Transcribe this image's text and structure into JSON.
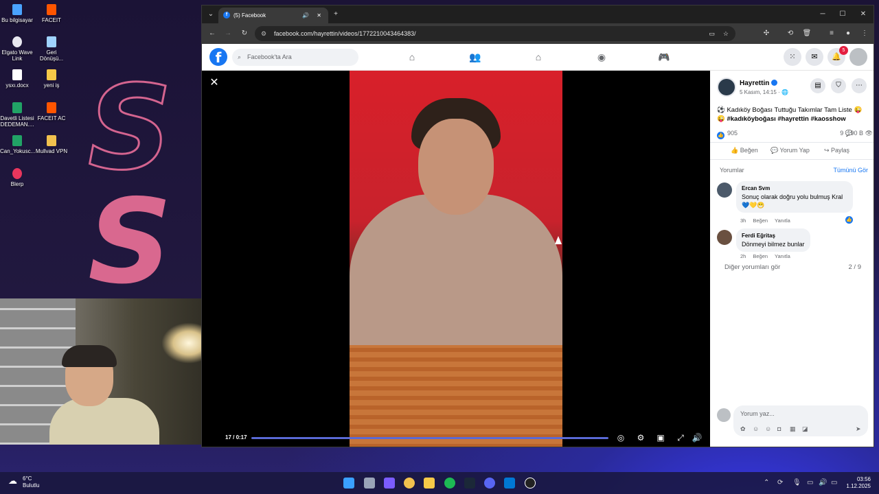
{
  "desktop": {
    "icons": [
      {
        "label": "Bu bilgisayar",
        "icon": "computer-icon",
        "color": "#4aa3ff"
      },
      {
        "label": "FACEIT",
        "icon": "faceit-icon",
        "color": "#ff5500"
      },
      {
        "label": "Elgato Wave Link",
        "icon": "elgato-icon",
        "color": "#ffffff"
      },
      {
        "label": "Geri Dönüşü...",
        "icon": "recycle-bin-icon",
        "color": "#9fd3ff"
      },
      {
        "label": "ysxı.docx",
        "icon": "document-icon",
        "color": "#ffffff"
      },
      {
        "label": "yeni iş",
        "icon": "folder-icon",
        "color": "#f7c948"
      },
      {
        "label": "Davetli Listesi DEDEMAN....",
        "icon": "spreadsheet-icon",
        "color": "#21a366"
      },
      {
        "label": "FACEIT AC",
        "icon": "faceit-ac-icon",
        "color": "#ff5500"
      },
      {
        "label": "Can_Yokusc...",
        "icon": "spreadsheet-icon",
        "color": "#21a366"
      },
      {
        "label": "Mullvad VPN",
        "icon": "mullvad-icon",
        "color": "#f2c14e"
      },
      {
        "label": "Blerp",
        "icon": "blerp-icon",
        "color": "#e8365d"
      }
    ]
  },
  "browser": {
    "tab_title": "(5) Facebook",
    "url": "facebook.com/hayrettin/videos/1772210043464383/"
  },
  "facebook": {
    "search_placeholder": "Facebook'ta Ara",
    "notification_count": "5",
    "brand_color": "#1877f2"
  },
  "video": {
    "time": "17 / 0:17",
    "progress": 1.0
  },
  "post": {
    "author": "Hayrettin",
    "date": "5 Kasım, 14:15 ·",
    "text": "⚽ Kadıköy Boğası Tuttuğu Takımlar Tam Liste 😜😜",
    "hashtags": "#kadıköyboğası #hayrettin #kaosshow",
    "reactions": "905",
    "comments_count": "9",
    "views": "190 B",
    "like_label": "Beğen",
    "comment_label": "Yorum Yap",
    "share_label": "Paylaş"
  },
  "comments": {
    "header": "Yorumlar",
    "see_all": "Tümünü Gör",
    "items": [
      {
        "name": "Ercan Svm",
        "text": "Sonuç olarak doğru yolu bulmuş Kral 💙💛😁",
        "time": "3h",
        "like": "Beğen",
        "reply": "Yanıtla"
      },
      {
        "name": "Ferdi Eğritaş",
        "text": "Dönmeyi bilmez bunlar",
        "time": "2h",
        "like": "Beğen",
        "reply": "Yanıtla"
      }
    ],
    "more": "Diğer yorumları gör",
    "pager": "2 / 9",
    "input_placeholder": "Yorum yaz..."
  },
  "taskbar": {
    "temperature": "6°C",
    "weather": "Bulutlu",
    "time": "03:56",
    "date": "1.12.2025"
  }
}
